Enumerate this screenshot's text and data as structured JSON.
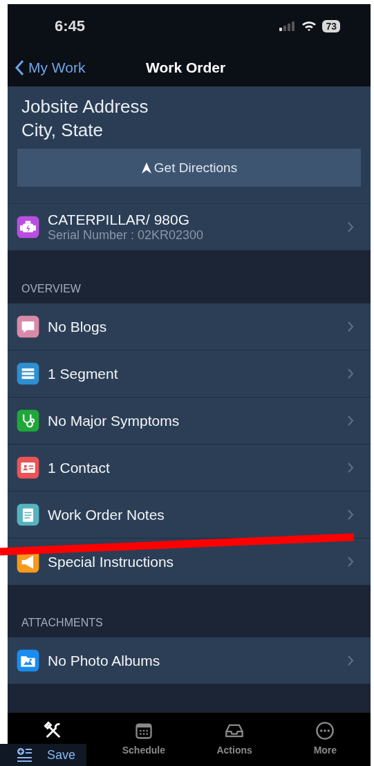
{
  "status_bar": {
    "time": "6:45",
    "battery": "73"
  },
  "nav_bar": {
    "back": "My Work",
    "title": "Work Order"
  },
  "address": {
    "lines": [
      "Jobsite Address",
      "City, State"
    ],
    "directions_button": "Get Directions"
  },
  "equipment": {
    "kind": "engine",
    "color": "#b94fe0",
    "title": "CATERPILLAR/ 980G",
    "subtitle": "Serial Number : 02KR02300"
  },
  "sections": [
    {
      "header": "OVERVIEW",
      "items": [
        {
          "kind": "blog",
          "color": "#d98aaa",
          "label": "No Blogs"
        },
        {
          "kind": "segment",
          "color": "#2f8fd0",
          "label": "1 Segment"
        },
        {
          "kind": "stethoscope",
          "color": "#1fa83a",
          "label": "No Major Symptoms"
        },
        {
          "kind": "contact",
          "color": "#ea5456",
          "label": "1 Contact"
        },
        {
          "kind": "notes",
          "color": "#55b3bf",
          "label": "Work Order Notes"
        },
        {
          "kind": "megaphone",
          "color": "#f59a1c",
          "label": "Special Instructions"
        }
      ]
    },
    {
      "header": "ATTACHMENTS",
      "items": [
        {
          "kind": "album",
          "color": "#1a8cf0",
          "label": "No Photo Albums"
        }
      ]
    }
  ],
  "tab_bar": [
    {
      "kind": "tools",
      "selected": true
    },
    {
      "kind": "calendar",
      "label": "Schedule",
      "selected": false
    },
    {
      "kind": "inbox",
      "label": "Actions",
      "selected": false
    },
    {
      "kind": "more",
      "label": "More",
      "selected": false
    }
  ],
  "save_overlay": {
    "label": "Save"
  }
}
